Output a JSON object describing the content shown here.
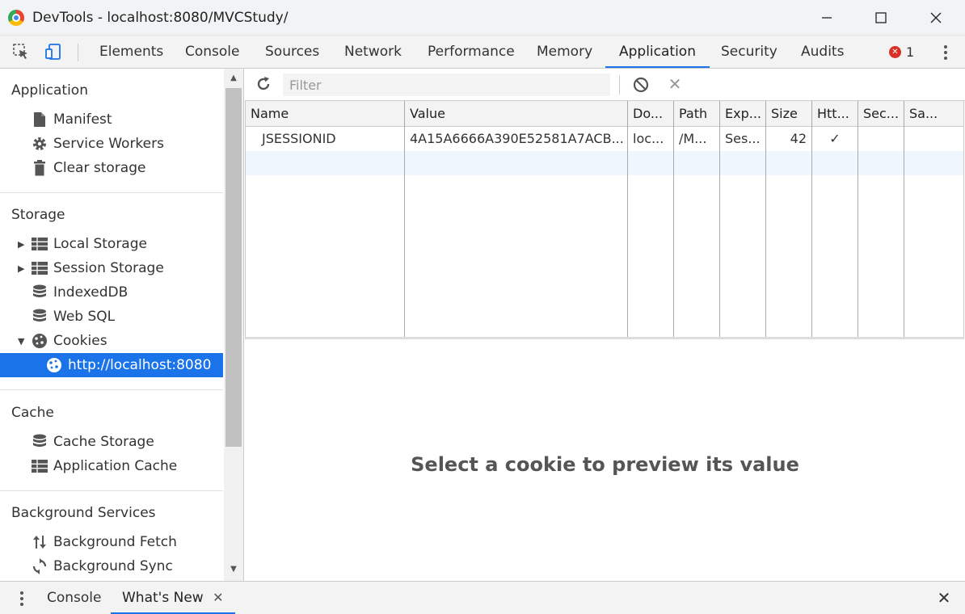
{
  "window": {
    "title": "DevTools - localhost:8080/MVCStudy/",
    "minimize": "—",
    "maximize": "☐",
    "close": "✕"
  },
  "tabs": [
    {
      "label": "Elements"
    },
    {
      "label": "Console"
    },
    {
      "label": "Sources"
    },
    {
      "label": "Network"
    },
    {
      "label": "Performance"
    },
    {
      "label": "Memory"
    },
    {
      "label": "Application",
      "active": true
    },
    {
      "label": "Security"
    },
    {
      "label": "Audits"
    }
  ],
  "errors": {
    "count": "1",
    "symbol": "✕"
  },
  "sidebar": {
    "application": {
      "title": "Application",
      "items": [
        "Manifest",
        "Service Workers",
        "Clear storage"
      ]
    },
    "storage": {
      "title": "Storage",
      "items": [
        "Local Storage",
        "Session Storage",
        "IndexedDB",
        "Web SQL",
        "Cookies"
      ],
      "cookie_origin": "http://localhost:8080"
    },
    "cache": {
      "title": "Cache",
      "items": [
        "Cache Storage",
        "Application Cache"
      ]
    },
    "background": {
      "title": "Background Services",
      "items": [
        "Background Fetch",
        "Background Sync"
      ]
    }
  },
  "toolbar": {
    "filter_placeholder": "Filter",
    "delete_symbol": "✕"
  },
  "cookies_table": {
    "columns": [
      "Name",
      "Value",
      "Do...",
      "Path",
      "Exp...",
      "Size",
      "Htt...",
      "Sec...",
      "Sa..."
    ],
    "rows": [
      {
        "name": "JSESSIONID",
        "value": "4A15A6666A390E52581A7ACB...",
        "domain": "loc...",
        "path": "/M...",
        "expires": "Ses...",
        "size": "42",
        "httponly": "✓",
        "secure": "",
        "samesite": ""
      }
    ]
  },
  "preview": {
    "message": "Select a cookie to preview its value"
  },
  "drawer": {
    "tabs": [
      {
        "label": "Console"
      },
      {
        "label": "What's New",
        "active": true
      }
    ],
    "close_symbol": "✕"
  }
}
